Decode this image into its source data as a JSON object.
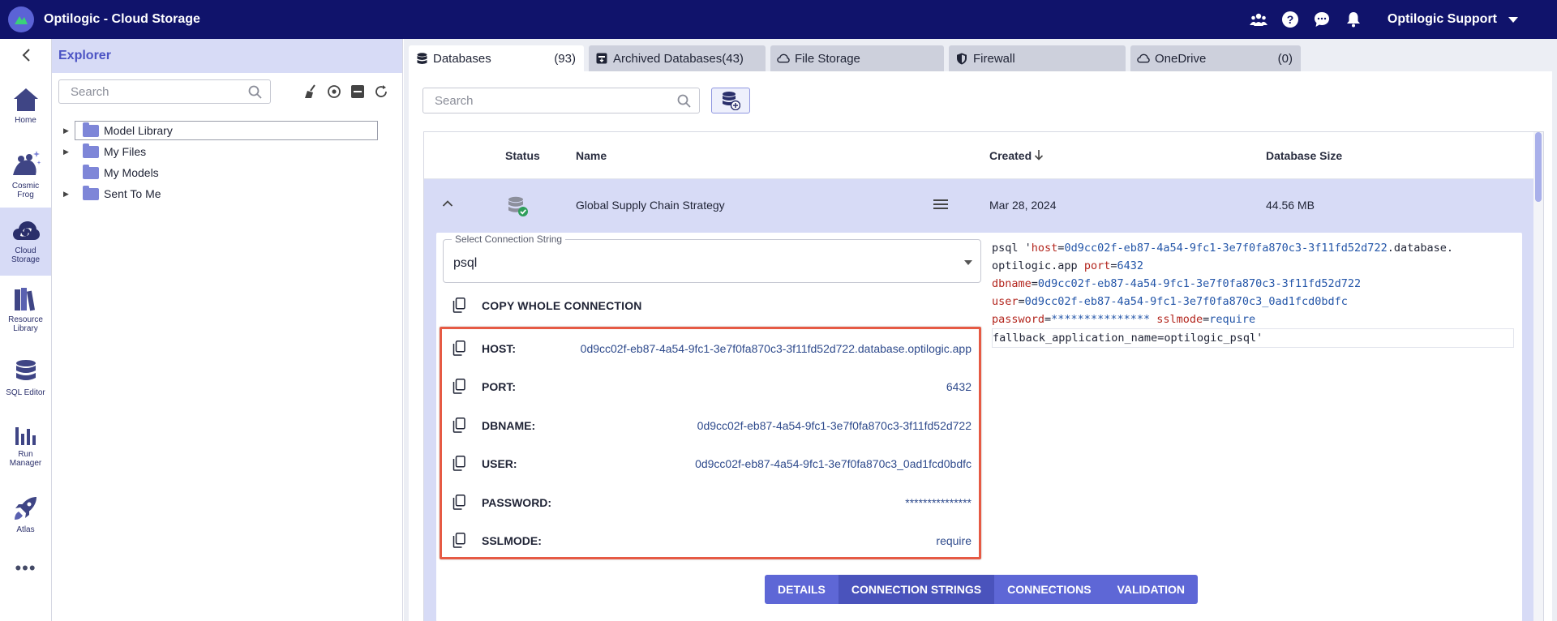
{
  "app": {
    "title": "Optilogic - Cloud Storage",
    "user": "Optilogic Support"
  },
  "nav": {
    "items": [
      {
        "label": "Home"
      },
      {
        "label": "Cosmic Frog"
      },
      {
        "label": "Cloud Storage"
      },
      {
        "label": "Resource Library"
      },
      {
        "label": "SQL Editor"
      },
      {
        "label": "Run Manager"
      },
      {
        "label": "Atlas"
      }
    ],
    "more": "•••"
  },
  "explorer": {
    "title": "Explorer",
    "search_placeholder": "Search",
    "tree": [
      {
        "label": "Model Library",
        "expandable": true,
        "selected": true
      },
      {
        "label": "My Files",
        "expandable": true
      },
      {
        "label": "My Models",
        "expandable": false
      },
      {
        "label": "Sent To Me",
        "expandable": true
      }
    ]
  },
  "tabs": [
    {
      "label": "Databases",
      "count": "(93)"
    },
    {
      "label": "Archived Databases(43)",
      "count": ""
    },
    {
      "label": "File Storage",
      "count": ""
    },
    {
      "label": "Firewall",
      "count": ""
    },
    {
      "label": "OneDrive",
      "count": "(0)"
    }
  ],
  "db_search_placeholder": "Search",
  "table": {
    "headers": {
      "status": "Status",
      "name": "Name",
      "created": "Created",
      "size": "Database Size"
    },
    "row": {
      "name": "Global Supply Chain Strategy",
      "created": "Mar 28, 2024",
      "size": "44.56 MB"
    }
  },
  "connection": {
    "select_label": "Select Connection String",
    "select_value": "psql",
    "copy_whole": "COPY WHOLE CONNECTION",
    "fields": [
      {
        "key": "HOST:",
        "value": "0d9cc02f-eb87-4a54-9fc1-3e7f0fa870c3-3f11fd52d722.database.optilogic.app"
      },
      {
        "key": "PORT:",
        "value": "6432"
      },
      {
        "key": "DBNAME:",
        "value": "0d9cc02f-eb87-4a54-9fc1-3e7f0fa870c3-3f11fd52d722"
      },
      {
        "key": "USER:",
        "value": "0d9cc02f-eb87-4a54-9fc1-3e7f0fa870c3_0ad1fcd0bdfc"
      },
      {
        "key": "PASSWORD:",
        "value": "***************"
      },
      {
        "key": "SSLMODE:",
        "value": "require"
      }
    ],
    "code": {
      "l1_prefix": "psql '",
      "l1_key": "host",
      "l1_val": "0d9cc02f-eb87-4a54-9fc1-3e7f0fa870c3-3f11fd52d722",
      "l1_tail": ".database.",
      "l2_host_tail": "optilogic.app",
      "l2_key": "port",
      "l2_val": "6432",
      "l3_key": "dbname",
      "l3_val": "0d9cc02f-eb87-4a54-9fc1-3e7f0fa870c3-3f11fd52d722",
      "l4_key": "user",
      "l4_val": "0d9cc02f-eb87-4a54-9fc1-3e7f0fa870c3_0ad1fcd0bdfc",
      "l5_key": "password",
      "l5_val": "***************",
      "l5_key2": "sslmode",
      "l5_val2": "require",
      "l6": "fallback_application_name=optilogic_psql'"
    }
  },
  "detail_tabs": [
    "DETAILS",
    "CONNECTION STRINGS",
    "CONNECTIONS",
    "VALIDATION"
  ],
  "colors": {
    "topbar": "#10136b",
    "accent": "#5e67d6",
    "row_highlight": "#d7dbf6",
    "callout": "#e65a44"
  }
}
